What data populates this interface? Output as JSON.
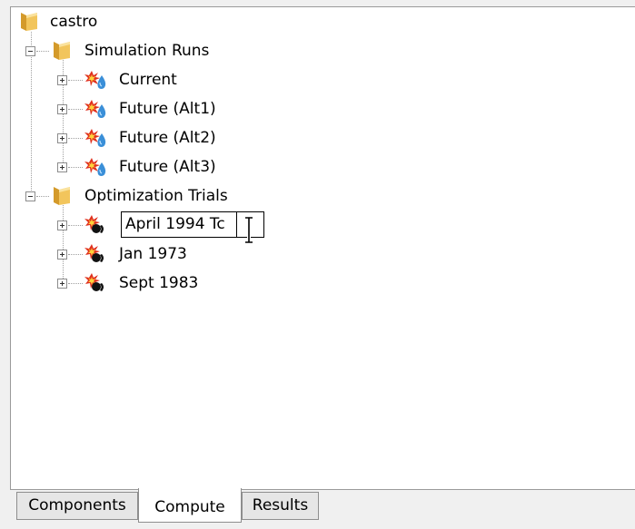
{
  "tree": {
    "root": {
      "label": "castro",
      "icon": "folder-icon"
    },
    "groups": [
      {
        "label": "Simulation Runs",
        "icon": "folder-icon",
        "items": [
          {
            "label": "Current",
            "icon": "simulation-run-icon"
          },
          {
            "label": "Future (Alt1)",
            "icon": "simulation-run-icon"
          },
          {
            "label": "Future (Alt2)",
            "icon": "simulation-run-icon"
          },
          {
            "label": "Future (Alt3)",
            "icon": "simulation-run-icon"
          }
        ]
      },
      {
        "label": "Optimization Trials",
        "icon": "folder-icon",
        "items": [
          {
            "label": "April 1994 Tc",
            "icon": "optimization-trial-icon",
            "editing": true
          },
          {
            "label": "Jan 1973",
            "icon": "optimization-trial-icon"
          },
          {
            "label": "Sept 1983",
            "icon": "optimization-trial-icon"
          }
        ]
      }
    ]
  },
  "tabs": [
    {
      "label": "Components",
      "active": false
    },
    {
      "label": "Compute",
      "active": true
    },
    {
      "label": "Results",
      "active": false
    }
  ],
  "colors": {
    "folder": "#e8b84a",
    "burst": "#e0301e",
    "water_drop": "#3a8fd8"
  }
}
